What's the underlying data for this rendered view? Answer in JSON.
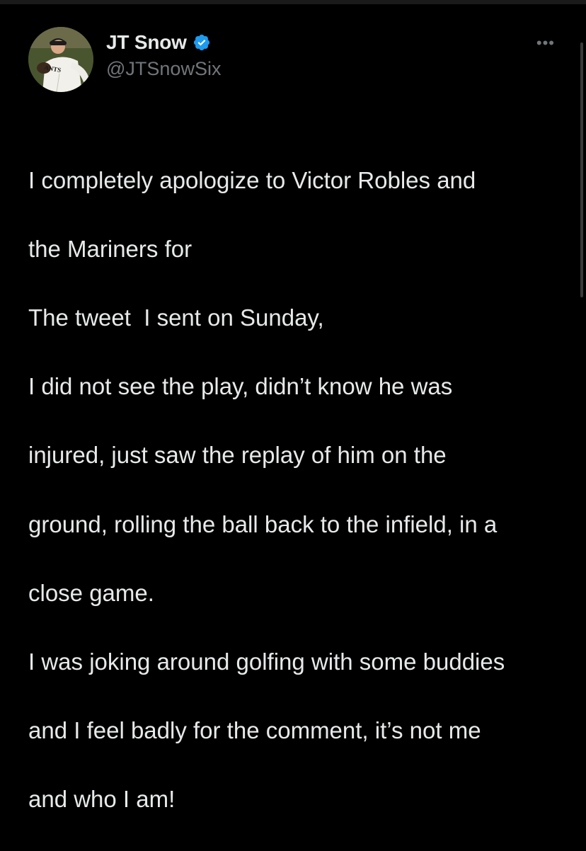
{
  "tweet": {
    "author": {
      "display_name": "JT Snow",
      "handle": "@JTSnowSix",
      "verified": true,
      "avatar_icon": "baseball-player-avatar",
      "avatar_jersey_text": "ANTS"
    },
    "more_label": "•••",
    "lines": [
      "I completely apologize to Victor Robles and",
      "the Mariners for",
      "The tweet  I sent on Sunday,",
      "I did not see the play, didn’t know he was",
      "injured, just saw the replay of him on the",
      "ground, rolling the ball back to the infield, in a",
      "close game.",
      "I was joking around golfing with some buddies",
      "and I feel badly for the comment, it’s not me",
      "and who I am!"
    ]
  },
  "colors": {
    "background": "#000000",
    "text_primary": "#e7e9ea",
    "text_secondary": "#71767b",
    "verified_blue": "#1d9bf0"
  }
}
